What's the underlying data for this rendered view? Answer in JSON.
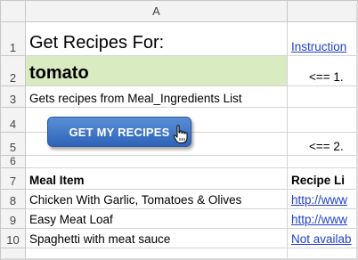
{
  "column_headers": [
    "A"
  ],
  "row_numbers": [
    "1",
    "2",
    "3",
    "4",
    "5",
    "6",
    "7",
    "8",
    "9",
    "10"
  ],
  "cells": {
    "a1": "Get Recipes For:",
    "b1": "Instruction",
    "a2": "tomato",
    "b2": "<== 1.",
    "a3": "Gets recipes from Meal_Ingredients List",
    "b5": "<== 2.",
    "a7": "Meal Item",
    "b7": "Recipe Li"
  },
  "button": {
    "label": "GET MY RECIPES"
  },
  "meals": [
    {
      "item": "Chicken With Garlic, Tomatoes & Olives",
      "link": "http://www"
    },
    {
      "item": "Easy Meat Loaf",
      "link": "http://www"
    },
    {
      "item": "Spaghetti with meat sauce",
      "link": "Not availab"
    }
  ],
  "colors": {
    "highlight": "#d9ebc0",
    "link": "#1f3fcf",
    "button": "#3a72c4"
  },
  "icons": {
    "cursor": "hand-pointer-icon"
  }
}
